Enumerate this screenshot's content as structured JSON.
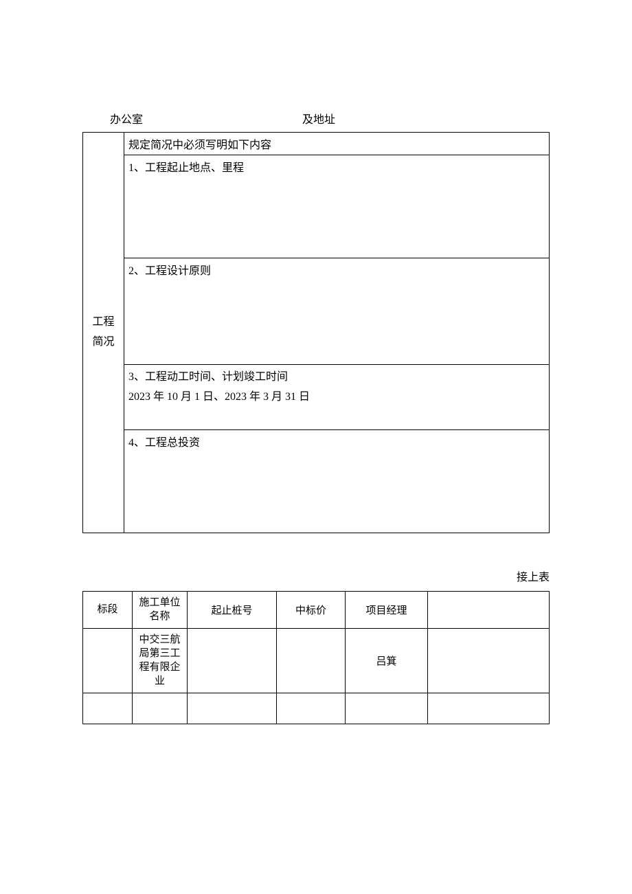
{
  "header": {
    "left": "办公室",
    "right": "及地址"
  },
  "mainTable": {
    "sideLabel": "工程简况",
    "rows": [
      "规定简况中必须写明如下内容",
      "1、工程起止地点、里程",
      "2、工程设计原则",
      "3、工程动工时间、计划竣工时间\n2023 年 10 月 1 日、2023 年 3 月 31 日",
      "4、工程总投资"
    ]
  },
  "continueLabel": "接上表",
  "secondTable": {
    "headers": [
      "标段",
      "施工单位名称",
      "起止桩号",
      "中标价",
      "项目经理",
      ""
    ],
    "rows": [
      [
        "",
        "中交三航局第三工程有限企业",
        "",
        "",
        "吕箕",
        ""
      ],
      [
        "",
        "",
        "",
        "",
        "",
        ""
      ]
    ]
  }
}
